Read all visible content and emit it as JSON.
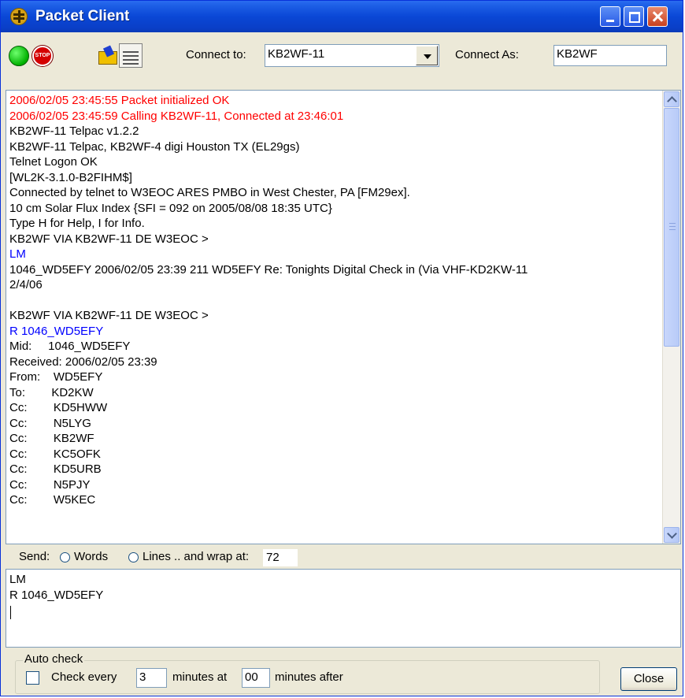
{
  "window": {
    "title": "Packet Client"
  },
  "toolbar": {
    "stop_label": "STOP",
    "connect_to_label": "Connect to:",
    "connect_to_value": "KB2WF-11",
    "connect_as_label": "Connect As:",
    "connect_as_value": "KB2WF"
  },
  "log": {
    "lines": [
      {
        "text": "2006/02/05 23:45:55 Packet initialized OK",
        "color": "red"
      },
      {
        "text": "2006/02/05 23:45:59 Calling KB2WF-11, Connected at 23:46:01",
        "color": "red"
      },
      {
        "text": "KB2WF-11 Telpac v1.2.2",
        "color": "black"
      },
      {
        "text": "KB2WF-11 Telpac, KB2WF-4 digi Houston TX (EL29gs)",
        "color": "black"
      },
      {
        "text": "Telnet Logon OK",
        "color": "black"
      },
      {
        "text": "[WL2K-3.1.0-B2FIHM$]",
        "color": "black"
      },
      {
        "text": "Connected by telnet to W3EOC ARES PMBO in West Chester, PA [FM29ex].",
        "color": "black"
      },
      {
        "text": "10 cm Solar Flux Index {SFI = 092 on 2005/08/08 18:35 UTC}",
        "color": "black"
      },
      {
        "text": "Type H for Help, I for Info.",
        "color": "black"
      },
      {
        "text": "KB2WF VIA KB2WF-11 DE W3EOC >",
        "color": "black"
      },
      {
        "text": "LM",
        "color": "blue"
      },
      {
        "text": "1046_WD5EFY 2006/02/05 23:39 211 WD5EFY Re: Tonights Digital Check in (Via VHF-KD2KW-11",
        "color": "black"
      },
      {
        "text": "2/4/06",
        "color": "black"
      },
      {
        "text": "",
        "color": "black"
      },
      {
        "text": "KB2WF VIA KB2WF-11 DE W3EOC >",
        "color": "black"
      },
      {
        "text": "R 1046_WD5EFY",
        "color": "blue"
      },
      {
        "text": "Mid:     1046_WD5EFY",
        "color": "black"
      },
      {
        "text": "Received: 2006/02/05 23:39",
        "color": "black"
      },
      {
        "text": "From:    WD5EFY",
        "color": "black"
      },
      {
        "text": "To:        KD2KW",
        "color": "black"
      },
      {
        "text": "Cc:        KD5HWW",
        "color": "black"
      },
      {
        "text": "Cc:        N5LYG",
        "color": "black"
      },
      {
        "text": "Cc:        KB2WF",
        "color": "black"
      },
      {
        "text": "Cc:        KC5OFK",
        "color": "black"
      },
      {
        "text": "Cc:        KD5URB",
        "color": "black"
      },
      {
        "text": "Cc:        N5PJY",
        "color": "black"
      },
      {
        "text": "Cc:        W5KEC",
        "color": "black"
      }
    ]
  },
  "send": {
    "label": "Send:",
    "words_label": "Words",
    "lines_label": "Lines .. and wrap at:",
    "wrap_value": "72"
  },
  "editor": {
    "lines": [
      "LM",
      "R 1046_WD5EFY"
    ]
  },
  "auto_check": {
    "group_label": "Auto check",
    "check_label": "Check every",
    "minutes_value": "3",
    "minutes_at_label": "minutes at",
    "after_value": "00",
    "after_label": "minutes after"
  },
  "close_label": "Close",
  "colors": {
    "red": "#ff0000",
    "blue": "#0000ff",
    "black": "#000000"
  }
}
